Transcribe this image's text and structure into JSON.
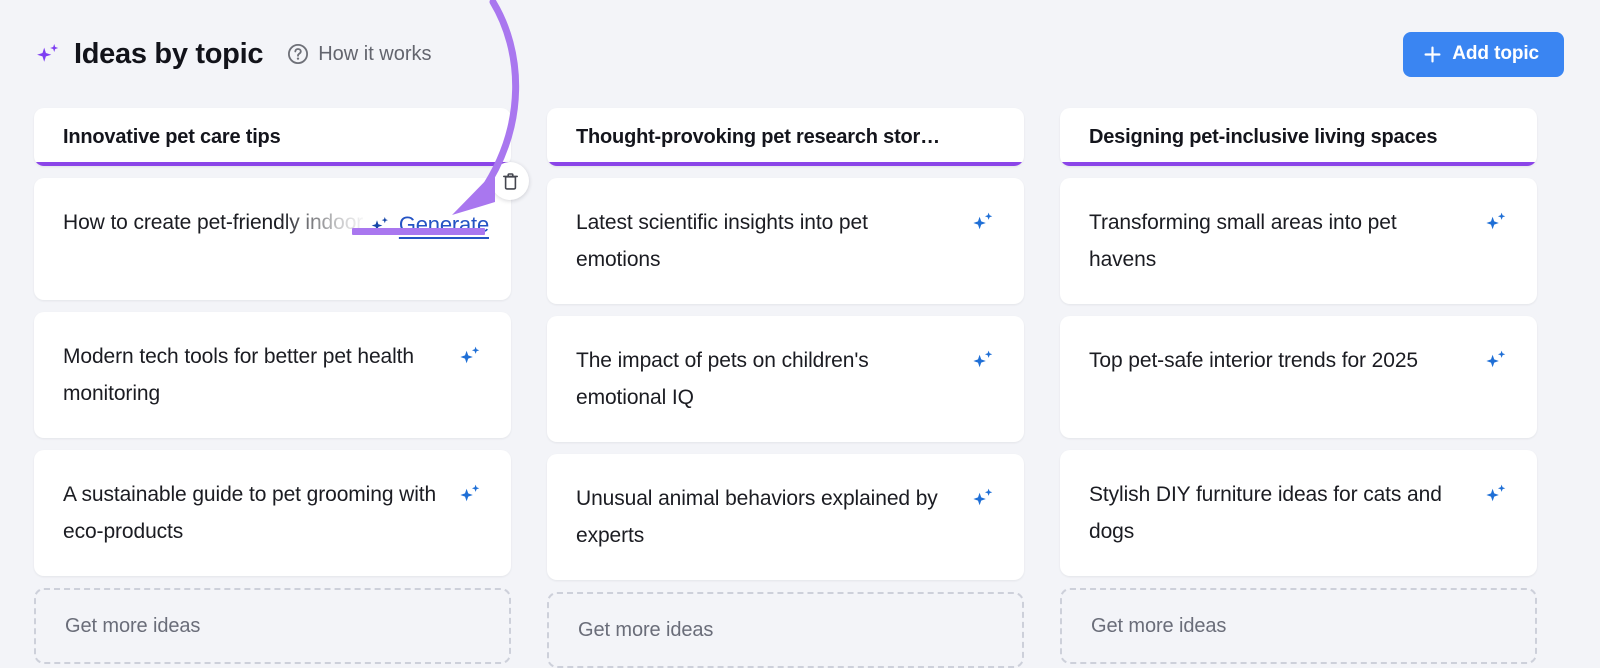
{
  "header": {
    "sparkle_icon": "sparkle-icon",
    "title": "Ideas by topic",
    "help_icon": "question-circle-icon",
    "help_label": "How it works",
    "add_topic_label": "Add topic",
    "add_topic_icon": "plus-icon"
  },
  "colors": {
    "page_background": "#f3f4f8",
    "card_background": "#ffffff",
    "accent_purple": "#8b45e8",
    "annotation_purple": "#a977ef",
    "primary_blue": "#3a85f2",
    "sparkle_blue": "#1f6fd6",
    "link_blue": "#2453c4",
    "muted_text": "#6a6d79",
    "dashed_border": "#cdd0da"
  },
  "overlay": {
    "generate_label": "Generate",
    "generate_icon": "sparkle-icon",
    "delete_icon": "trash-icon"
  },
  "columns": [
    {
      "title": "Innovative pet care tips",
      "get_more_label": "Get more ideas",
      "ideas": [
        {
          "text": "How to create pet-friendly indoor gardens",
          "icon": "sparkle-icon"
        },
        {
          "text": "Modern tech tools for better pet health monitoring",
          "icon": "sparkle-icon"
        },
        {
          "text": "A sustainable guide to pet grooming with eco-products",
          "icon": "sparkle-icon"
        }
      ]
    },
    {
      "title": "Thought-provoking pet research stor…",
      "get_more_label": "Get more ideas",
      "ideas": [
        {
          "text": "Latest scientific insights into pet emotions",
          "icon": "sparkle-icon"
        },
        {
          "text": "The impact of pets on children's emotional IQ",
          "icon": "sparkle-icon"
        },
        {
          "text": "Unusual animal behaviors explained by experts",
          "icon": "sparkle-icon"
        }
      ]
    },
    {
      "title": "Designing pet-inclusive living spaces",
      "get_more_label": "Get more ideas",
      "ideas": [
        {
          "text": "Transforming small areas into pet havens",
          "icon": "sparkle-icon"
        },
        {
          "text": "Top pet-safe interior trends for 2025",
          "icon": "sparkle-icon"
        },
        {
          "text": "Stylish DIY furniture ideas for cats and dogs",
          "icon": "sparkle-icon"
        }
      ]
    }
  ]
}
